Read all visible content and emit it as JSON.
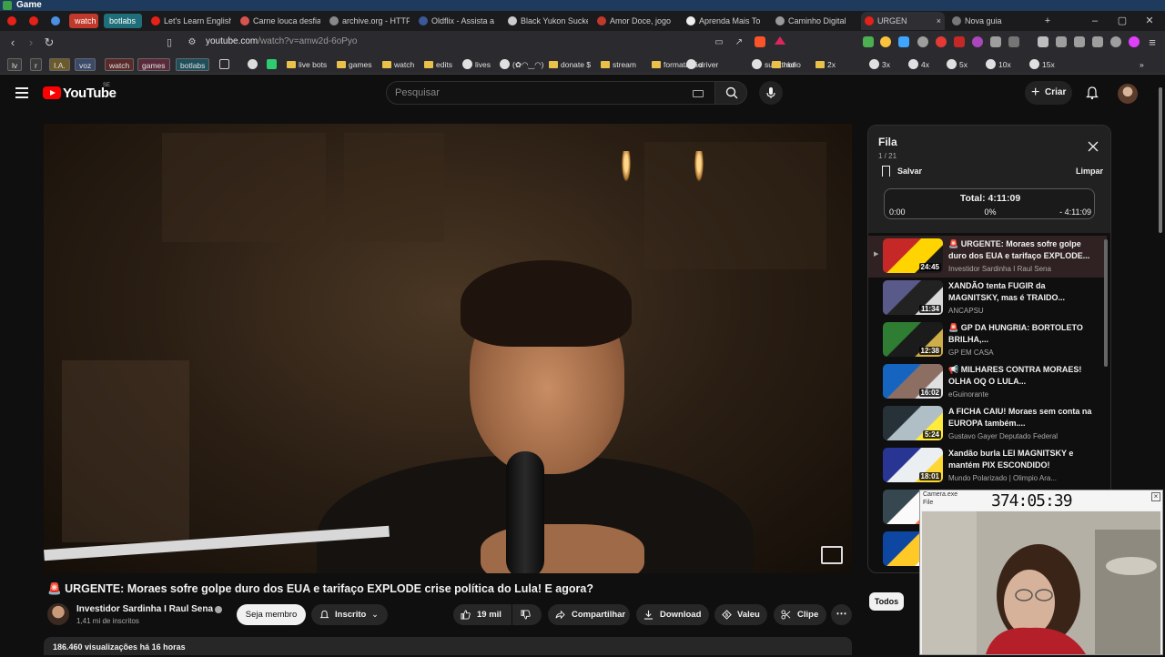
{
  "window": {
    "title": "Game"
  },
  "tabs": [
    {
      "label": "",
      "color": "#e62117"
    },
    {
      "label": "",
      "color": "#e62117"
    },
    {
      "label": "",
      "color": "#4a90e2"
    },
    {
      "label": "watch",
      "color": "#c0392b",
      "pill": true
    },
    {
      "label": "botlabs",
      "color": "#1f6f7a",
      "pill": true
    },
    {
      "label": "Let's Learn English",
      "color": "#e62117"
    },
    {
      "label": "Carne louca desfia",
      "color": "#d9534f"
    },
    {
      "label": "archive.org - HTTP",
      "color": "#888888"
    },
    {
      "label": "Oldflix - Assista a",
      "color": "#3b5998"
    },
    {
      "label": "Black Yukon Sucke",
      "color": "#cccccc"
    },
    {
      "label": "Amor Doce, jogo",
      "color": "#c0392b"
    },
    {
      "label": "Aprenda Mais To",
      "color": "#eeeeee"
    },
    {
      "label": "Caminho Digital",
      "color": "#999999"
    },
    {
      "label": "URGEN",
      "color": "#e62117",
      "active": true
    },
    {
      "label": "Nova guia",
      "color": "#777777"
    }
  ],
  "address": {
    "host": "youtube.com",
    "path": "/watch?v=amw2d-6oPyo"
  },
  "bookmarks": {
    "tags": [
      "lv",
      "r",
      "I.A.",
      "voz",
      "watch",
      "games",
      "botlabs"
    ],
    "items": [
      "live bots",
      "games",
      "watch",
      "edits",
      "lives",
      "(✿◠‿◠)",
      "donate $",
      "stream",
      "formatação",
      "driver",
      "subathon",
      "rádio",
      "2x",
      "3x",
      "4x",
      "5x",
      "10x",
      "15x"
    ]
  },
  "header": {
    "logo": "YouTube",
    "region": "SE",
    "search_placeholder": "Pesquisar",
    "create_label": "Criar"
  },
  "video": {
    "title": "URGENTE: Moraes sofre golpe duro dos EUA e tarifaço EXPLODE crise política do Lula! E agora?",
    "title_emoji": "🚨",
    "channel": "Investidor Sardinha I Raul Sena",
    "subscribers": "1,41 mi de inscritos",
    "join_label": "Seja membro",
    "subscribed_label": "Inscrito",
    "likes": "19 mil",
    "share_label": "Compartilhar",
    "download_label": "Download",
    "thanks_label": "Valeu",
    "clip_label": "Clipe",
    "views": "186.460 visualizações",
    "age": "há 16 horas"
  },
  "queue": {
    "title": "Fila",
    "position": "1 / 21",
    "save_label": "Salvar",
    "clear_label": "Limpar",
    "total": "Total: 4:11:09",
    "start": "0:00",
    "percent": "0%",
    "remaining": "- 4:11:09",
    "items": [
      {
        "title": "🚨 URGENTE: Moraes sofre golpe duro dos EUA e tarifaço EXPLODE...",
        "channel": "Investidor Sardinha I Raul Sena",
        "duration": "24:45",
        "current": true,
        "thumb": [
          "#c62828",
          "#1a1a1a",
          "#ffd400"
        ]
      },
      {
        "title": "XANDÃO tenta FUGIR da MAGNITSKY, mas é TRAIDO...",
        "channel": "ANCAPSU",
        "duration": "11:34",
        "thumb": [
          "#5a5a8a",
          "#d9d9d9",
          "#222222"
        ]
      },
      {
        "title": "🚨 GP DA HUNGRIA: BORTOLETO BRILHA,...",
        "channel": "GP EM CASA",
        "duration": "12:38",
        "thumb": [
          "#2e7d32",
          "#cfae4a",
          "#1b1b1b"
        ]
      },
      {
        "title": "📢 MILHARES CONTRA MORAES! OLHA OQ O LULA...",
        "channel": "eGuinorante",
        "duration": "16:02",
        "thumb": [
          "#1565c0",
          "#e0e0e0",
          "#8d6e63"
        ]
      },
      {
        "title": "A FICHA CAIU! Moraes sem conta na EUROPA também....",
        "channel": "Gustavo Gayer Deputado Federal",
        "duration": "5:24",
        "thumb": [
          "#263238",
          "#ffeb3b",
          "#b0bec5"
        ]
      },
      {
        "title": "Xandão burla LEI MAGNITSKY e mantém PIX ESCONDIDO!",
        "channel": "Mundo Polarizado | Olimpio Ara...",
        "duration": "18:01",
        "thumb": [
          "#283593",
          "#fdd835",
          "#eceff1"
        ]
      },
      {
        "title": "",
        "channel": "",
        "duration": "",
        "thumb": [
          "#37474f",
          "#ff7043",
          "#fafafa"
        ]
      },
      {
        "title": "",
        "channel": "",
        "duration": "",
        "thumb": [
          "#0d47a1",
          "#ffffff",
          "#ffca28"
        ]
      }
    ]
  },
  "chips": {
    "all_label": "Todos"
  },
  "camera": {
    "title": "Camera.exe",
    "menu": "File",
    "clock": "374:05:39"
  }
}
